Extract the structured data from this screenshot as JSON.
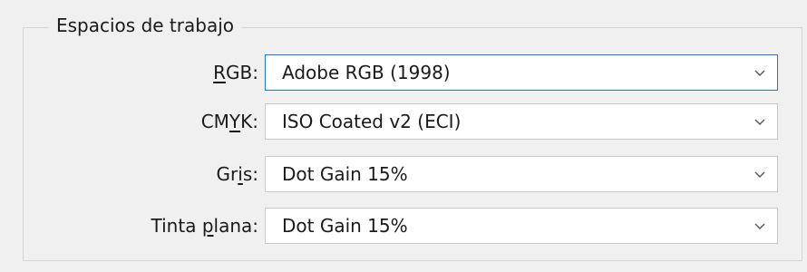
{
  "group": {
    "title": "Espacios de trabajo"
  },
  "rows": [
    {
      "label_mnemonic": "R",
      "label_rest": "GB:",
      "value": "Adobe RGB (1998)",
      "focused": true
    },
    {
      "label_pre": "CM",
      "label_mnemonic": "Y",
      "label_rest": "K:",
      "value": "ISO Coated v2 (ECI)"
    },
    {
      "label_pre": "Gr",
      "label_mnemonic": "i",
      "label_rest": "s:",
      "value": "Dot Gain 15%"
    },
    {
      "label_pre": "Tinta ",
      "label_mnemonic": "p",
      "label_rest": "lana:",
      "value": "Dot Gain 15%"
    }
  ],
  "icons": {
    "dropdown": "chevron-down-icon"
  },
  "colors": {
    "background": "#f0f0f0",
    "focus_border": "#1a73e8",
    "field_border": "#c9c9c9"
  }
}
